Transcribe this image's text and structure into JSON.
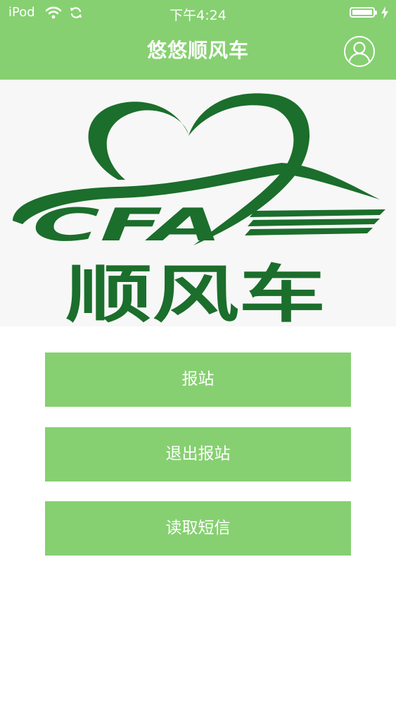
{
  "status_bar": {
    "device": "iPod",
    "time": "下午4:24"
  },
  "header": {
    "title": "悠悠顺风车"
  },
  "banner": {
    "logo_letters": "CFA",
    "logo_text": "顺风车"
  },
  "actions": [
    {
      "label": "报站"
    },
    {
      "label": "退出报站"
    },
    {
      "label": "读取短信"
    }
  ],
  "colors": {
    "accent": "#86d071",
    "logo_green": "#1b6e2b"
  },
  "icons": [
    "wifi-icon",
    "sync-icon",
    "battery-icon",
    "charging-icon",
    "user-profile-icon"
  ]
}
